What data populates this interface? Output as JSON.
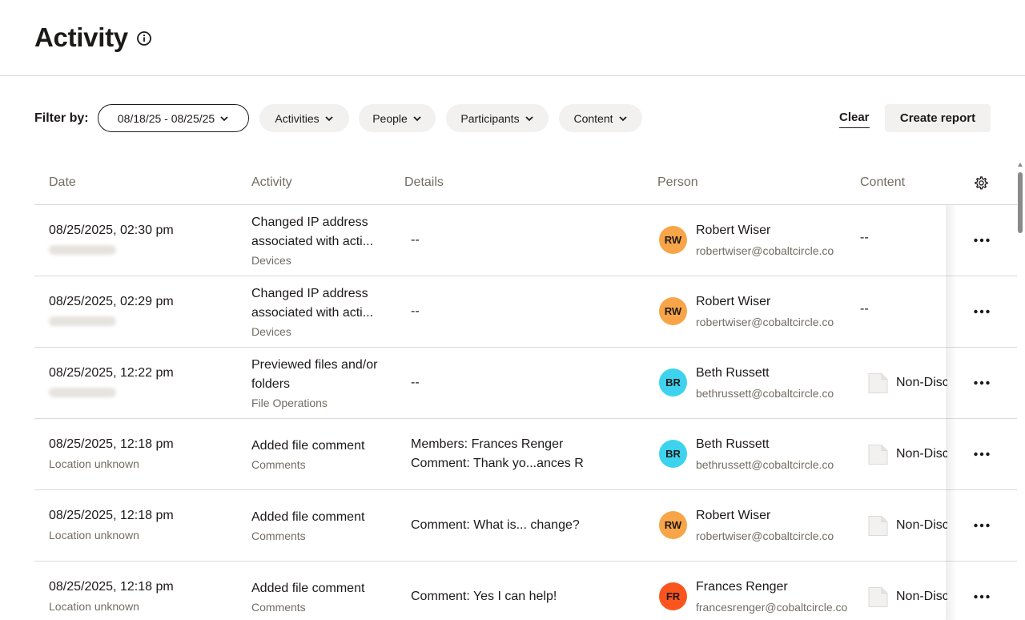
{
  "header": {
    "title": "Activity",
    "info_icon": "info-icon"
  },
  "filters": {
    "label": "Filter by:",
    "date_range": "08/18/25 - 08/25/25",
    "activities": "Activities",
    "people": "People",
    "participants": "Participants",
    "content": "Content",
    "clear": "Clear",
    "create_report": "Create report"
  },
  "table": {
    "columns": {
      "date": "Date",
      "activity": "Activity",
      "details": "Details",
      "person": "Person",
      "content": "Content"
    },
    "settings_icon": "gear-icon",
    "rows": [
      {
        "date": "08/25/2025, 02:30 pm",
        "location": "",
        "activity": "Changed IP address associated with acti...",
        "category": "Devices",
        "details_1": "--",
        "details_2": "",
        "initials": "RW",
        "avatar_color": "#f7a548",
        "name": "Robert Wiser",
        "email": "robertwiser@cobaltcircle.co",
        "content": "--"
      },
      {
        "date": "08/25/2025, 02:29 pm",
        "location": "",
        "activity": "Changed IP address associated with acti...",
        "category": "Devices",
        "details_1": "--",
        "details_2": "",
        "initials": "RW",
        "avatar_color": "#f7a548",
        "name": "Robert Wiser",
        "email": "robertwiser@cobaltcircle.co",
        "content": "--"
      },
      {
        "date": "08/25/2025, 12:22 pm",
        "location": "",
        "activity": "Previewed files and/or folders",
        "category": "File Operations",
        "details_1": "--",
        "details_2": "",
        "initials": "BR",
        "avatar_color": "#3dd3ee",
        "name": "Beth Russett",
        "email": "bethrussett@cobaltcircle.co",
        "content": "Non-Disclosure"
      },
      {
        "date": "08/25/2025, 12:18 pm",
        "location": "Location unknown",
        "activity": "Added file comment",
        "category": "Comments",
        "details_1": "Members: Frances Renger",
        "details_2": "Comment: Thank yo...ances R",
        "initials": "BR",
        "avatar_color": "#3dd3ee",
        "name": "Beth Russett",
        "email": "bethrussett@cobaltcircle.co",
        "content": "Non-Disclosure"
      },
      {
        "date": "08/25/2025, 12:18 pm",
        "location": "Location unknown",
        "activity": "Added file comment",
        "category": "Comments",
        "details_1": "Comment: What is... change?",
        "details_2": "",
        "initials": "RW",
        "avatar_color": "#f7a548",
        "name": "Robert Wiser",
        "email": "robertwiser@cobaltcircle.co",
        "content": "Non-Disclosure"
      },
      {
        "date": "08/25/2025, 12:18 pm",
        "location": "Location unknown",
        "activity": "Added file comment",
        "category": "Comments",
        "details_1": "Comment: Yes I can help!",
        "details_2": "",
        "initials": "FR",
        "avatar_color": "#fa551e",
        "name": "Frances Renger",
        "email": "francesrenger@cobaltcircle.co",
        "content": "Non-Disclosure"
      }
    ],
    "more_icon": "more-horizontal-icon"
  }
}
